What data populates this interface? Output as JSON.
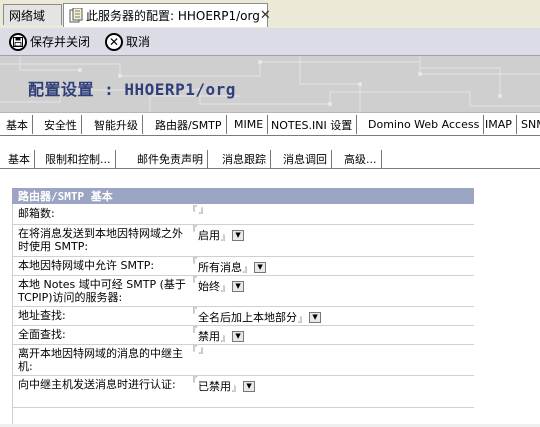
{
  "window_tabs": [
    {
      "label": "网络域"
    },
    {
      "label": "此服务器的配置: HHOERP1/org"
    }
  ],
  "action_bar": {
    "save_close_label": "保存并关闭",
    "cancel_label": "取消"
  },
  "banner": {
    "title": "配置设置 : HHOERP1/org"
  },
  "main_tabs": [
    {
      "label": "基本"
    },
    {
      "label": "安全性"
    },
    {
      "label": "智能升级"
    },
    {
      "label": "路由器/SMTP"
    },
    {
      "label": "MIME"
    },
    {
      "label": "NOTES.INI 设置"
    },
    {
      "label": "Domino Web Access"
    },
    {
      "label": "IMAP"
    },
    {
      "label": "SNM"
    }
  ],
  "sub_tabs": [
    {
      "label": "基本"
    },
    {
      "label": "限制和控制..."
    },
    {
      "label": "邮件免责声明"
    },
    {
      "label": "消息跟踪"
    },
    {
      "label": "消息调回"
    },
    {
      "label": "高级..."
    }
  ],
  "section": {
    "title": "路由器/SMTP 基本",
    "fields": [
      {
        "label": "邮箱数:",
        "value": "",
        "dropdown": false
      },
      {
        "label": "在将消息发送到本地因特网域之外时使用 SMTP:",
        "value": "启用",
        "dropdown": true
      },
      {
        "label": "本地因特网域中允许 SMTP:",
        "value": "所有消息",
        "dropdown": true
      },
      {
        "label": "本地 Notes 域中可经 SMTP (基于 TCPIP)访问的服务器:",
        "value": "始终",
        "dropdown": true
      },
      {
        "label": "地址查找:",
        "value": "全名后加上本地部分",
        "dropdown": true
      },
      {
        "label": "全面查找:",
        "value": "禁用",
        "dropdown": true
      },
      {
        "label": "离开本地因特网域的消息的中继主机:",
        "value": "",
        "dropdown": false
      },
      {
        "label": "向中继主机发送消息时进行认证:",
        "value": "已禁用",
        "dropdown": true
      }
    ]
  },
  "colors": {
    "section_header_bg": "#9ba4c2",
    "title_color": "#2f3f7a",
    "action_bar_bg": "#dcdce6"
  }
}
